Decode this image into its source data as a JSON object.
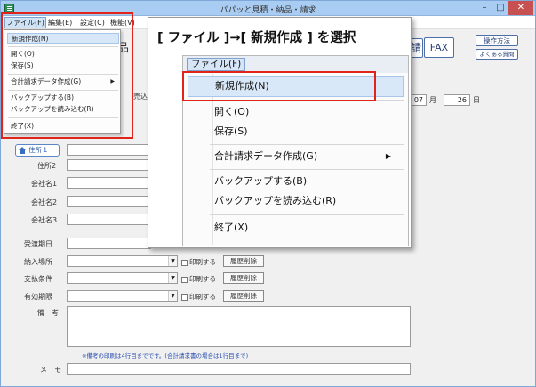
{
  "window": {
    "title": "パパッと見積・納品・請求",
    "min": "–",
    "max": "□",
    "close": "✕"
  },
  "menubar": {
    "file": "ファイル(F)",
    "edit": "編集(E)",
    "settings": "設定(C)",
    "misc": "機能(V)"
  },
  "file_menu_small": {
    "new": "新規作成(N)",
    "open": "開く(O)",
    "save": "保存(S)",
    "billing": "合計請求データ作成(G)",
    "backup": "バックアップする(B)",
    "restore": "バックアップを読み込む(R)",
    "exit": "終了(X)"
  },
  "callout": {
    "title": "[ ファイル ]→[ 新規作成 ] を選択",
    "menu_label": "ファイル(F)",
    "new": "新規作成(N)",
    "open": "開く(O)",
    "save": "保存(S)",
    "billing": "合計請求データ作成(G)",
    "backup": "バックアップする(B)",
    "restore": "バックアップを読み込む(R)",
    "exit": "終了(X)"
  },
  "toolbar_partial": {
    "hin": "品",
    "shoukomi": "売込",
    "fax": "FAX",
    "how_to": "操作方法",
    "faq": "よくある質問",
    "sei": "請"
  },
  "date": {
    "month_value": "07",
    "month_unit": "月",
    "day_value": "26",
    "day_unit": "日"
  },
  "form": {
    "address_button": "住所１",
    "address2": "住所2",
    "company1": "会社名1",
    "company2": "会社名2",
    "company3": "会社名3",
    "delivery_date": "受渡期日",
    "delivery_place": "納入場所",
    "payment_terms": "支払条件",
    "validity": "有効期限",
    "remarks": "備　考",
    "memo": "メ　モ",
    "print_label": "印刷する",
    "clear_history": "履歴削除",
    "remarks_note": "※備考の印刷は4行目までです。(合計請求書の場合は1行目まで)"
  },
  "colors": {
    "highlight_red": "#e2231a",
    "titlebar": "#a9cdf2",
    "menu_highlight": "#d9e8f8"
  }
}
